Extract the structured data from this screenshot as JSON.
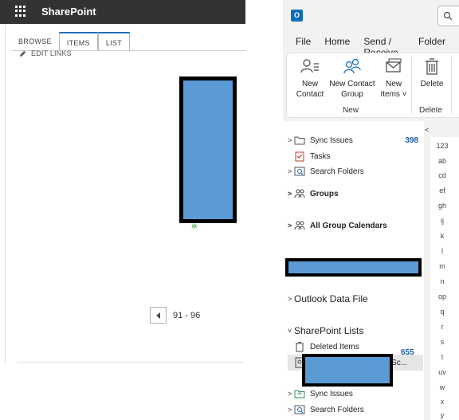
{
  "sharepoint": {
    "title": "SharePoint",
    "tabs": [
      {
        "label": "BROWSE"
      },
      {
        "label": "ITEMS"
      },
      {
        "label": "LIST"
      }
    ],
    "edit_links": "EDIT LINKS",
    "pager": {
      "range": "91 - 96"
    },
    "colors": {
      "topbar": "#333333",
      "accent": "#1d6fb8",
      "redaction": "#5b9bd5"
    }
  },
  "outlook": {
    "menu": [
      "File",
      "Home",
      "Send / Receive",
      "Folder"
    ],
    "ribbon": {
      "buttons": [
        {
          "label": "New Contact",
          "icon": "new-contact-icon"
        },
        {
          "label": "New Contact Group",
          "icon": "new-contact-group-icon"
        },
        {
          "label": "New Items ˅",
          "icon": "new-items-icon"
        },
        {
          "label": "Delete",
          "icon": "delete-icon"
        }
      ],
      "groups": [
        "New",
        "Delete"
      ]
    },
    "folders": [
      {
        "label": "Sync Issues",
        "count": "398",
        "icon": "folder-icon"
      },
      {
        "label": "Tasks",
        "icon": "tasks-icon"
      },
      {
        "label": "Search Folders",
        "icon": "search-folder-icon"
      },
      {
        "label": "Groups",
        "icon": "groups-icon"
      },
      {
        "label": "All Group Calendars",
        "icon": "groups-icon"
      },
      {
        "label": "Outlook Data File"
      },
      {
        "label": "SharePoint Lists"
      },
      {
        "label": "Deleted Items",
        "icon": "trash-icon"
      },
      {
        "label": "- Sc...",
        "count": "655",
        "icon": "contacts-icon"
      },
      {
        "label": "Sync Issues",
        "icon": "sync-folder-icon"
      },
      {
        "label": "Search Folders",
        "icon": "search-folder-icon"
      }
    ],
    "alpha_index": [
      "123",
      "ab",
      "cd",
      "ef",
      "gh",
      "ij",
      "k",
      "l",
      "m",
      "n",
      "op",
      "q",
      "r",
      "s",
      "t",
      "uv",
      "w",
      "x",
      "y"
    ]
  }
}
